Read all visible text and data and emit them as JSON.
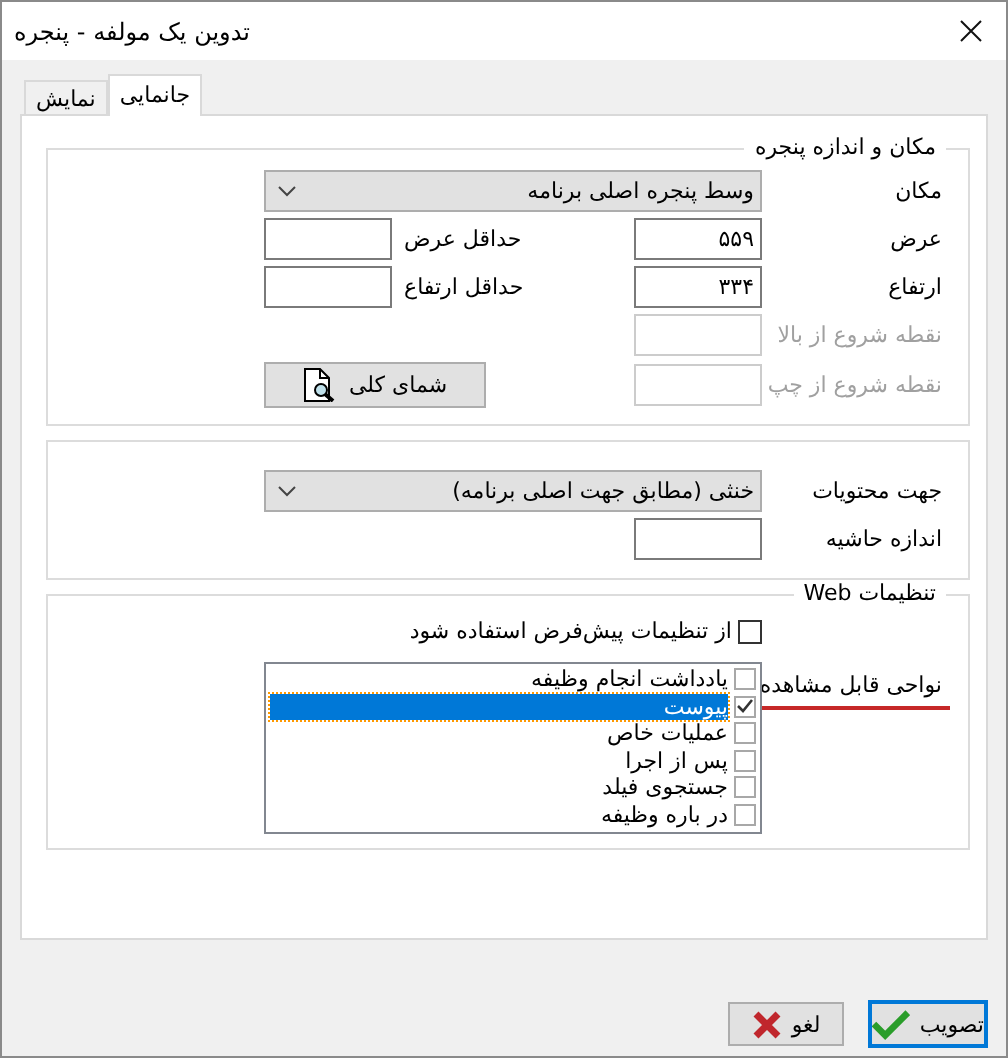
{
  "window": {
    "title": "تدوین یک مولفه - پنجره"
  },
  "tabs": [
    {
      "label": "جانمایی",
      "selected": true
    },
    {
      "label": "نمایش",
      "selected": false
    }
  ],
  "location_group": {
    "legend": "مکان و اندازه پنجره",
    "position": {
      "label": "مکان",
      "value": "وسط پنجره اصلی برنامه"
    },
    "size_fields": [
      {
        "label": "عرض",
        "value": "۵۵۹",
        "disabled": false
      },
      {
        "label": "ارتفاع",
        "value": "۳۳۴",
        "disabled": false
      },
      {
        "label": "نقطه شروع از بالا",
        "disabled": true
      },
      {
        "label": "نقطه شروع از چپ",
        "disabled": true
      }
    ],
    "min_fields": [
      {
        "label": "حداقل عرض",
        "disabled": false
      },
      {
        "label": "حداقل ارتفاع",
        "disabled": false
      }
    ],
    "overview_button": "شمای کلی"
  },
  "direction_group": {
    "direction": {
      "label": "جهت محتویات",
      "value": "خنثی (مطابق جهت اصلی برنامه)"
    },
    "margin": {
      "label": "اندازه حاشیه"
    }
  },
  "web_group": {
    "legend": "تنظیمات Web",
    "use_defaults": {
      "label": "از تنظیمات پیش‌فرض استفاده شود",
      "checked": false
    },
    "visible_areas": {
      "label": "نواحی قابل مشاهده",
      "items": [
        {
          "label": "یادداشت انجام وظیفه",
          "checked": false,
          "selected": false
        },
        {
          "label": "پیوست",
          "checked": true,
          "selected": true
        },
        {
          "label": "عملیات خاص",
          "checked": false,
          "selected": false
        },
        {
          "label": "پس از اجرا",
          "checked": false,
          "selected": false
        },
        {
          "label": "جستجوی فیلد",
          "checked": false,
          "selected": false
        },
        {
          "label": "در باره وظیفه",
          "checked": false,
          "selected": false
        }
      ]
    }
  },
  "buttons": [
    {
      "kind": "ok",
      "label": "تصویب",
      "default": true
    },
    {
      "kind": "cancel",
      "label": "لغو",
      "default": false
    }
  ]
}
